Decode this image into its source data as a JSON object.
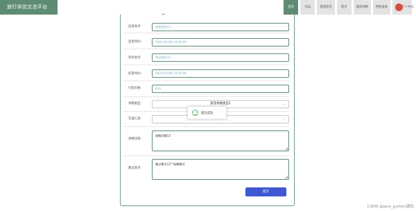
{
  "app": {
    "title": "旅行体验交流平台"
  },
  "nav": {
    "items": [
      "首页",
      "论坛",
      "旅游资讯",
      "景点",
      "旅游攻略",
      "特色美食"
    ],
    "active_index": 0,
    "user": "个人中心"
  },
  "form": {
    "fields": [
      {
        "label": "出发地点:",
        "value": "出发地点13"
      },
      {
        "label": "出发时间:",
        "value": "2023-03-06 14:42:49"
      },
      {
        "label": "到达地点:",
        "value": "到达地点13"
      },
      {
        "label": "结束时间:",
        "value": "2023-03-06 14:42:49"
      },
      {
        "label": "行程天数:",
        "value": "420"
      }
    ],
    "selects": [
      {
        "label": "攻略类型:",
        "value": "旅游攻略类型2"
      },
      {
        "label": "交通工具:",
        "value": ""
      }
    ],
    "textareas": [
      {
        "label": "攻略详情:",
        "value": "攻略详情13"
      },
      {
        "label": "路过景点:",
        "value": "路过景点13\"\"攻略格式"
      }
    ],
    "submit_label": "提交"
  },
  "toast": {
    "message": "提交成功"
  },
  "watermark": "CSDN @java_python源码",
  "colors": {
    "brand": "#5e8b73",
    "primary_button": "#3f57d1",
    "success": "#5fb878"
  }
}
